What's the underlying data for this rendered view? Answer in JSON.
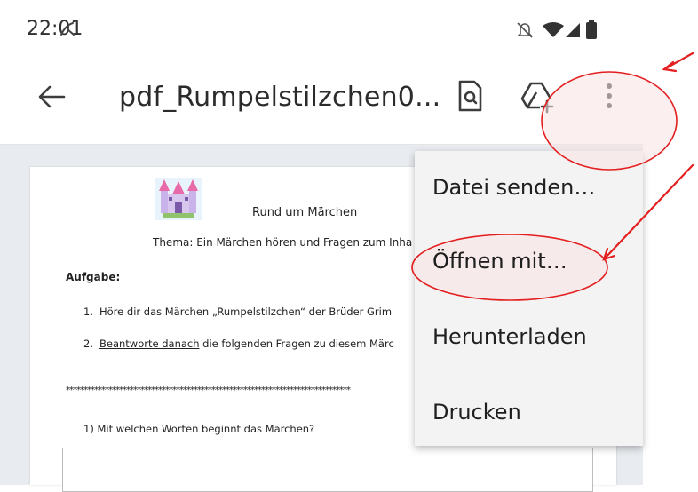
{
  "status_bar": {
    "time": "22:01"
  },
  "app_bar": {
    "title": "pdf_Rumpelstilzchen0..."
  },
  "document": {
    "heading": "Rund um Märchen",
    "theme": "Thema: Ein Märchen hören und Fragen zum Inha",
    "task_label": "Aufgabe:",
    "steps": [
      {
        "num": "1.",
        "text": "Höre dir das Märchen „Rumpelstilzchen“ der Brüder Grim"
      },
      {
        "num": "2.",
        "underlined": "Beantworte danach",
        "rest": " die folgenden Fragen zu diesem Märc"
      }
    ],
    "separator": "********************************************************************************",
    "question": "1)  Mit welchen Worten beginnt das Märchen?"
  },
  "menu": {
    "items": [
      "Datei senden…",
      "Öffnen mit…",
      "Herunterladen",
      "Drucken"
    ]
  },
  "colors": {
    "annotation": "#e41f1f",
    "highlight_fill": "#f7e1e1",
    "menu_bg": "#f3f3f3",
    "viewer_bg": "#e8ebef"
  }
}
